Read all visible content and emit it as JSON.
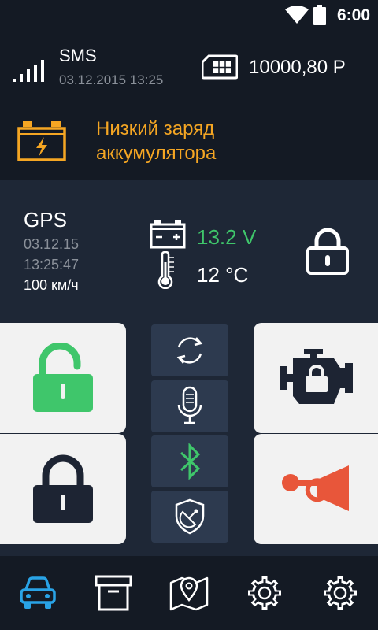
{
  "status_bar": {
    "time": "6:00"
  },
  "sms": {
    "title": "SMS",
    "datetime": "03.12.2015 13:25"
  },
  "balance": "10000,80 Р",
  "alert": {
    "line1": "Низкий заряд",
    "line2": "аккумулятора",
    "color": "#f5a623"
  },
  "gps": {
    "title": "GPS",
    "date": "03.12.15",
    "time": "13:25:47",
    "speed": "100 км/ч"
  },
  "vehicle": {
    "voltage": "13.2 V",
    "voltage_color": "#3fc66b",
    "temperature": "12 °C"
  },
  "controls": {
    "unlock": {
      "icon": "unlock-icon",
      "color": "#3fc66b"
    },
    "lock": {
      "icon": "lock-icon"
    },
    "engine": {
      "icon": "engine-lock-icon"
    },
    "horn": {
      "icon": "horn-icon",
      "color": "#e8563a"
    },
    "small": [
      "refresh-icon",
      "microphone-icon",
      "bluetooth-icon",
      "satellite-shield-icon"
    ]
  },
  "nav": {
    "items": [
      "car-icon",
      "archive-icon",
      "map-icon",
      "settings-icon",
      "settings-icon"
    ],
    "active_color": "#29a3e6"
  }
}
